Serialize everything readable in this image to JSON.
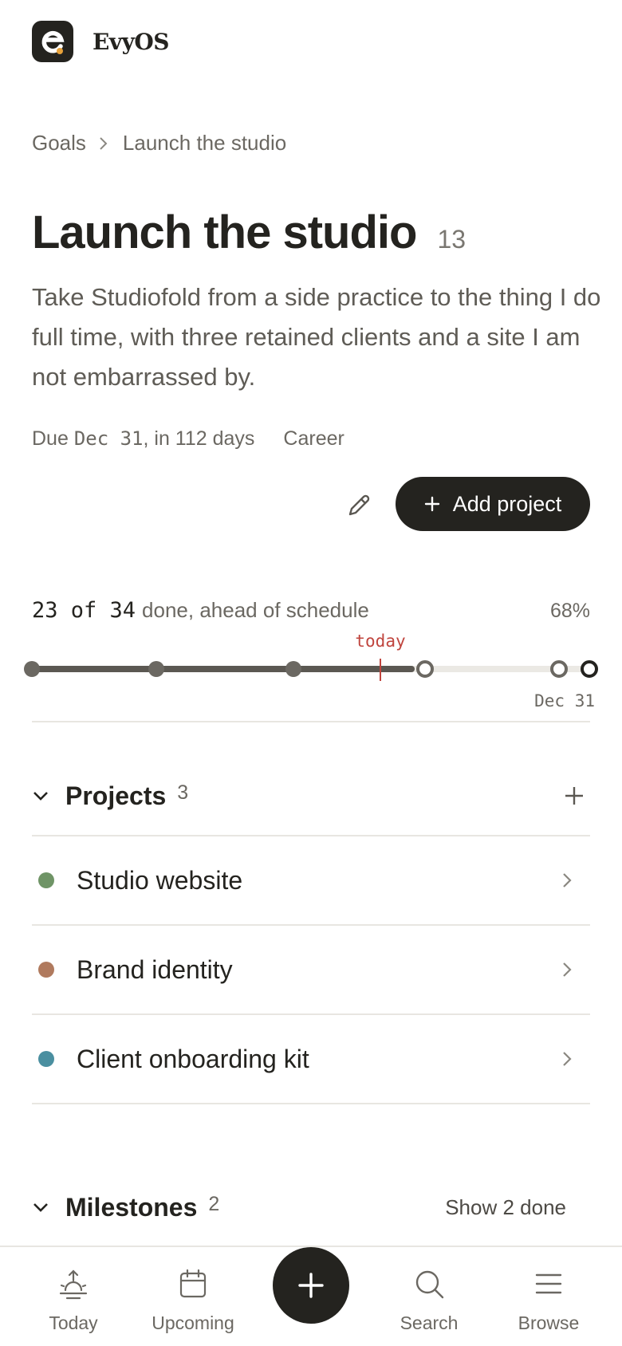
{
  "app": {
    "name": "EvyOS"
  },
  "breadcrumb": {
    "root": "Goals",
    "current": "Launch the studio"
  },
  "goal": {
    "title": "Launch the studio",
    "count": "13",
    "description": "Take Studiofold from a side practice to the thing I do full time, with three retained clients and a site I am not embarrassed by.",
    "due_prefix": "Due ",
    "due_date": "Dec 31",
    "due_suffix": ", in 112 days",
    "area": "Career"
  },
  "actions": {
    "add_project_label": "Add project"
  },
  "progress": {
    "done_count": "23 of 34",
    "summary": "done, ahead of schedule",
    "percent_label": "68%",
    "fraction": 0.68,
    "today_label": "today",
    "end_label": "Dec 31"
  },
  "projects": {
    "title": "Projects",
    "count": "3",
    "items": [
      {
        "label": "Studio website",
        "color": "#6f9466"
      },
      {
        "label": "Brand identity",
        "color": "#b07a5e"
      },
      {
        "label": "Client onboarding kit",
        "color": "#4a8fa0"
      }
    ]
  },
  "milestones": {
    "title": "Milestones",
    "count": "2",
    "show_done_label": "Show 2 done"
  },
  "nav": {
    "today": "Today",
    "upcoming": "Upcoming",
    "search": "Search",
    "browse": "Browse"
  },
  "colors": {
    "ink": "#24231f",
    "muted": "#6b6862",
    "accent_today": "#c0453e",
    "track_done": "#5b5852",
    "track_remaining": "#ebe9e4"
  }
}
